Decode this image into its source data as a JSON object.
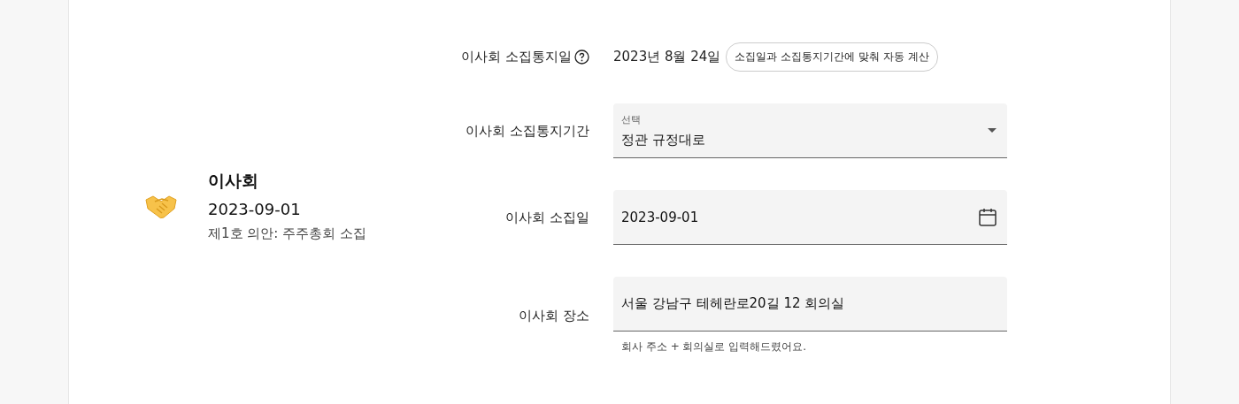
{
  "meeting": {
    "title": "이사회",
    "date": "2023-09-01",
    "agenda": "제1호 의안: 주주총회 소집"
  },
  "fields": [
    {
      "kind": "notice",
      "label": "이사회 소집통지일",
      "help": true,
      "value": "2023년 8월 24일",
      "chip": "소집일과 소집통지기간에 맞춰 자동 계산"
    },
    {
      "kind": "select",
      "label": "이사회 소집통지기간",
      "floating_label": "선택",
      "value": "정관 규정대로"
    },
    {
      "kind": "date",
      "label": "이사회 소집일",
      "value": "2023-09-01"
    },
    {
      "kind": "text",
      "label": "이사회 장소",
      "value": "서울 강남구 테헤란로20길 12 회의실",
      "helper": "회사 주소 + 회의실로 입력해드렸어요."
    }
  ]
}
